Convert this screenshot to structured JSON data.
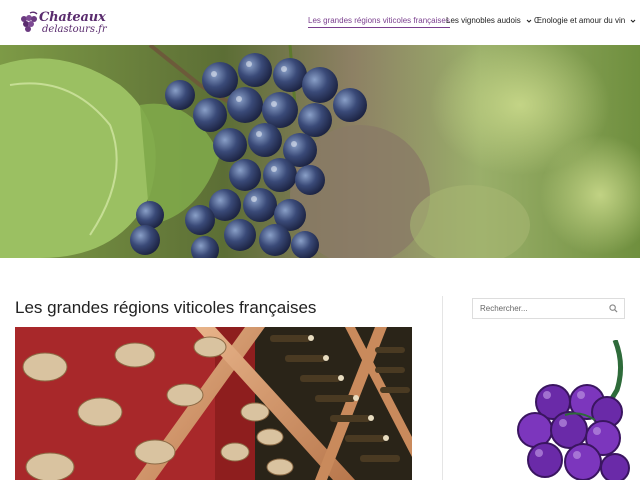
{
  "header": {
    "logo": {
      "line1": "Chateaux",
      "line2": "delastours.fr"
    },
    "nav": [
      {
        "label": "Les grandes régions viticoles françaises",
        "active": true,
        "has_dropdown": false
      },
      {
        "label": "Les vignobles audois",
        "active": false,
        "has_dropdown": true
      },
      {
        "label": "Œnologie et amour du vin",
        "active": false,
        "has_dropdown": true
      }
    ]
  },
  "hero": {
    "icon": "grape-vine-photo"
  },
  "article": {
    "title": "Les grandes régions viticoles françaises",
    "image_icon": "wine-bottle-rack-photo"
  },
  "sidebar": {
    "search": {
      "placeholder": "Rechercher..."
    },
    "illustration_icon": "grapes-illustration"
  },
  "colors": {
    "accent": "#7a3e8e",
    "border": "#dddddd"
  }
}
